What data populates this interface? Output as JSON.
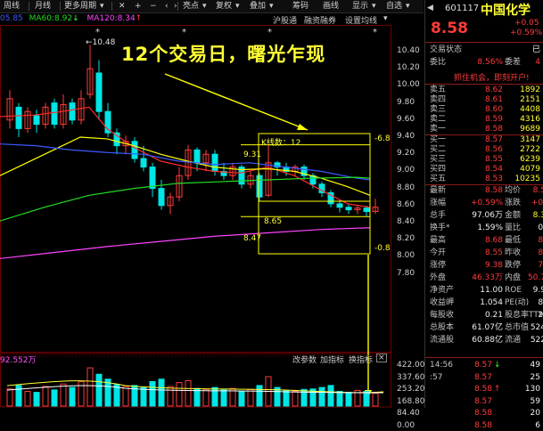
{
  "toolbar": {
    "items": [
      "周线",
      "月线",
      "更多周期",
      "亮点",
      "复权",
      "叠加",
      "筹码",
      "画线",
      "显示",
      "自选"
    ],
    "close_icon": "close-icon",
    "zoom_in": "+",
    "zoom_out": "−",
    "prev": "‹",
    "next": "›"
  },
  "ma_legend": {
    "ma5": "05.85",
    "ma60": "MA60:8.92",
    "ma60_arrow": "↓",
    "ma120": "MA120:8.34",
    "ma120_arrow": "↑"
  },
  "subtabs": [
    "沪股通",
    "融资融券",
    "设置均线"
  ],
  "annotation": {
    "headline": "12个交易日，曙光乍现",
    "kline_count": "K线数：12",
    "high_marker": "10.48",
    "box_top": "9.31",
    "box_mid": "8.65",
    "box_low": "8.47",
    "box_right_top": "-6.8",
    "box_right_bottom": "-0.8"
  },
  "price_axis": [
    "10.40",
    "10.20",
    "10.00",
    "9.80",
    "9.60",
    "9.40",
    "9.20",
    "9.00",
    "8.80",
    "8.60",
    "8.40",
    "8.20",
    "8.00",
    "7.80"
  ],
  "volume_pane": {
    "legend": "92.552万",
    "controls": [
      "改参数",
      "加指标",
      "换指标"
    ],
    "axis": [
      "422.00",
      "337.60",
      "253.20",
      "168.80",
      "84.40",
      "0.00"
    ]
  },
  "quote": {
    "code": "601117",
    "name": "中国化学",
    "price": "8.58",
    "change": "+0.05",
    "change_pct": "+0.59%",
    "status_label": "交易状态",
    "status_value": "已",
    "weibi_label": "委比",
    "weibi": "8.56%",
    "weicha_label": "委差",
    "weicha": "4",
    "ad": "抓住机会，即刻开户!",
    "asks": [
      {
        "label": "卖五",
        "price": "8.62",
        "vol": "1892"
      },
      {
        "label": "卖四",
        "price": "8.61",
        "vol": "2151"
      },
      {
        "label": "卖三",
        "price": "8.60",
        "vol": "4408"
      },
      {
        "label": "卖二",
        "price": "8.59",
        "vol": "4316"
      },
      {
        "label": "卖一",
        "price": "8.58",
        "vol": "9689"
      }
    ],
    "bids": [
      {
        "label": "买一",
        "price": "8.57",
        "vol": "3147"
      },
      {
        "label": "买二",
        "price": "8.56",
        "vol": "2722"
      },
      {
        "label": "买三",
        "price": "8.55",
        "vol": "6239"
      },
      {
        "label": "买四",
        "price": "8.54",
        "vol": "4079"
      },
      {
        "label": "买五",
        "price": "8.53",
        "vol": "10235"
      }
    ],
    "stats": [
      {
        "l": "最新",
        "v": "8.58",
        "c": "red",
        "l2": "均价",
        "v2": "8.5"
      },
      {
        "l": "涨幅",
        "v": "+0.59%",
        "c": "red",
        "l2": "涨跌",
        "v2": "+0."
      },
      {
        "l": "总手",
        "v": "97.06万",
        "c": "white",
        "l2": "金额",
        "v2": "8.3"
      },
      {
        "l": "换手*",
        "v": "1.59%",
        "c": "white",
        "l2": "量比",
        "v2": "0."
      },
      {
        "l": "最高",
        "v": "8.68",
        "c": "red",
        "l2": "最低",
        "v2": "8."
      },
      {
        "l": "今开",
        "v": "8.55",
        "c": "red",
        "l2": "昨收",
        "v2": "8."
      },
      {
        "l": "涨停",
        "v": "9.38",
        "c": "red",
        "l2": "跌停",
        "v2": "7."
      },
      {
        "l": "外盘",
        "v": "46.33万",
        "c": "red",
        "l2": "内盘",
        "v2": "50.7"
      },
      {
        "l": "净资产",
        "v": "11.00",
        "c": "white",
        "l2": "ROE",
        "v2": "9.9"
      },
      {
        "l": "收益岬",
        "v": "1.054",
        "c": "white",
        "l2": "PE(动)",
        "v2": "8."
      },
      {
        "l": "每股收",
        "v": "0.21",
        "c": "white",
        "l2": "股息率TTM",
        "v2": "2."
      },
      {
        "l": "总股本",
        "v": "61.07亿",
        "c": "white",
        "l2": "总市值",
        "v2": "524"
      },
      {
        "l": "流通股",
        "v": "60.88亿",
        "c": "white",
        "l2": "流通",
        "v2": "522"
      }
    ],
    "ticks": [
      {
        "time": "14:56",
        "price": "8.57",
        "arrow": "↓",
        "vol": "49",
        "pc": "red",
        "vc": "white",
        "ac": "green"
      },
      {
        "time": ":57",
        "price": "8.57",
        "arrow": "",
        "vol": "25",
        "pc": "red",
        "vc": "white",
        "ac": "red"
      },
      {
        "time": "",
        "price": "8.58",
        "arrow": "↑",
        "vol": "130",
        "pc": "red",
        "vc": "white",
        "ac": "red"
      },
      {
        "time": "",
        "price": "8.57",
        "arrow": "",
        "vol": "59",
        "pc": "red",
        "vc": "white",
        "ac": "red"
      },
      {
        "time": "",
        "price": "8.58",
        "arrow": "",
        "vol": "20",
        "pc": "red",
        "vc": "white",
        "ac": "red"
      },
      {
        "time": "",
        "price": "8.58",
        "arrow": "",
        "vol": "6",
        "pc": "red",
        "vc": "white",
        "ac": "red"
      }
    ]
  },
  "colors": {
    "up": "#ff3b3b",
    "down": "#00e5e5",
    "ma5": "#ffffff",
    "ma10": "#ffff00",
    "ma20": "#ff2a2a",
    "ma30": "#3b5bff",
    "ma60": "#22dd22",
    "ma120": "#ff44ff",
    "annotation": "#ffff00"
  }
}
